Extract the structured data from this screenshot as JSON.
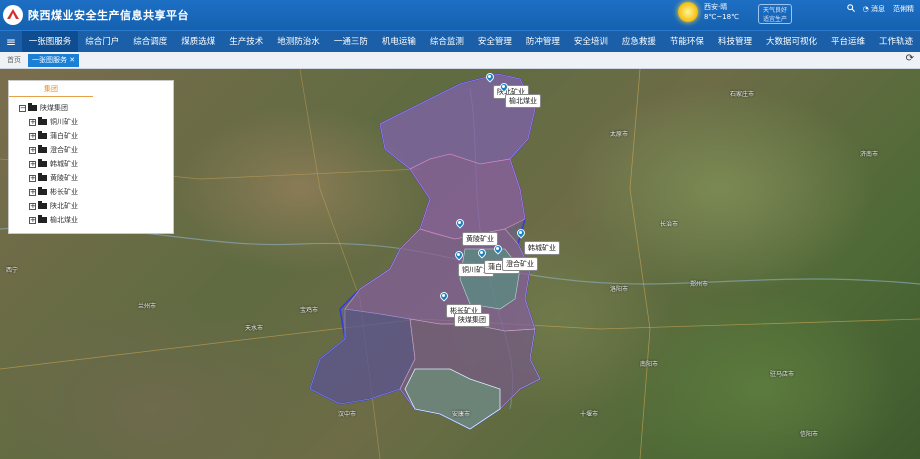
{
  "app": {
    "title": "陕西煤业安全生产信息共享平台"
  },
  "weather": {
    "city": "西安·晴",
    "temp": "8℃~18℃"
  },
  "air": {
    "line1": "天气良好",
    "line2": "适宜生产"
  },
  "header_icons": {
    "message": "消息",
    "user": "范俐精"
  },
  "nav": {
    "items": [
      "一张图服务",
      "综合门户",
      "综合调度",
      "煤质选煤",
      "生产技术",
      "地测防治水",
      "一通三防",
      "机电运输",
      "综合监测",
      "安全管理",
      "防冲管理",
      "安全培训",
      "应急救援",
      "节能环保",
      "科技管理",
      "大数据可视化",
      "平台运维",
      "工作轨迹"
    ]
  },
  "tabs": {
    "home": "首页",
    "current": "一张图服务"
  },
  "tree": {
    "tab_label": "集团",
    "root": "陕煤集团",
    "children": [
      "铜川矿业",
      "蒲白矿业",
      "澄合矿业",
      "韩城矿业",
      "黄陵矿业",
      "彬长矿业",
      "陕北矿业",
      "榆北煤业"
    ]
  },
  "markers": [
    {
      "label": "陕北矿业"
    },
    {
      "label": "榆北煤业"
    },
    {
      "label": "黄陵矿业"
    },
    {
      "label": "韩城矿业"
    },
    {
      "label": "铜川矿业"
    },
    {
      "label": "蒲白矿业"
    },
    {
      "label": "澄合矿业"
    },
    {
      "label": "彬长矿业"
    },
    {
      "label": "陕煤集团"
    }
  ],
  "cities": [
    "西宁",
    "兰州市",
    "天水市",
    "宝鸡市",
    "安康市",
    "汉中市",
    "十堰市",
    "洛阳市",
    "郑州市",
    "太原市",
    "石家庄市",
    "长治市",
    "济南市",
    "南阳市",
    "驻马店市",
    "信阳市"
  ]
}
